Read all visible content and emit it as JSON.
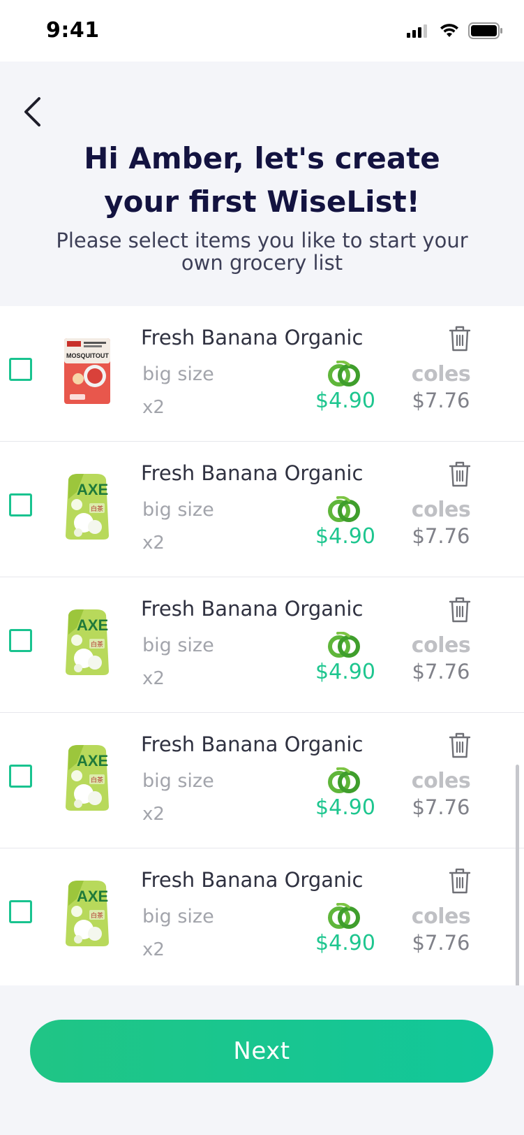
{
  "status_bar": {
    "time": "9:41"
  },
  "header": {
    "title": "Hi Amber, let's create your first WiseList!",
    "subtitle": "Please select items you like to start your own grocery list"
  },
  "items": [
    {
      "name": "Fresh Banana Organic",
      "size": "big size",
      "qty": "x2",
      "ww_price": "$4.90",
      "coles_logo": "coles",
      "coles_price": "$7.76",
      "image": "mosquito-repellent-pack"
    },
    {
      "name": "Fresh Banana Organic",
      "size": "big size",
      "qty": "x2",
      "ww_price": "$4.90",
      "coles_logo": "coles",
      "coles_price": "$7.76",
      "image": "axe-detergent-pouch"
    },
    {
      "name": "Fresh Banana Organic",
      "size": "big size",
      "qty": "x2",
      "ww_price": "$4.90",
      "coles_logo": "coles",
      "coles_price": "$7.76",
      "image": "axe-detergent-pouch"
    },
    {
      "name": "Fresh Banana Organic",
      "size": "big size",
      "qty": "x2",
      "ww_price": "$4.90",
      "coles_logo": "coles",
      "coles_price": "$7.76",
      "image": "axe-detergent-pouch"
    },
    {
      "name": "Fresh Banana Organic",
      "size": "big size",
      "qty": "x2",
      "ww_price": "$4.90",
      "coles_logo": "coles",
      "coles_price": "$7.76",
      "image": "axe-detergent-pouch"
    }
  ],
  "product_label_text": {
    "mosquito_brand": "MOSQUITOUT",
    "axe_brand": "AXE",
    "axe_sub": "白茶"
  },
  "footer": {
    "next_label": "Next"
  },
  "colors": {
    "accent": "#1ec68f",
    "title": "#131340",
    "coles_grey": "#bfc0c4"
  }
}
